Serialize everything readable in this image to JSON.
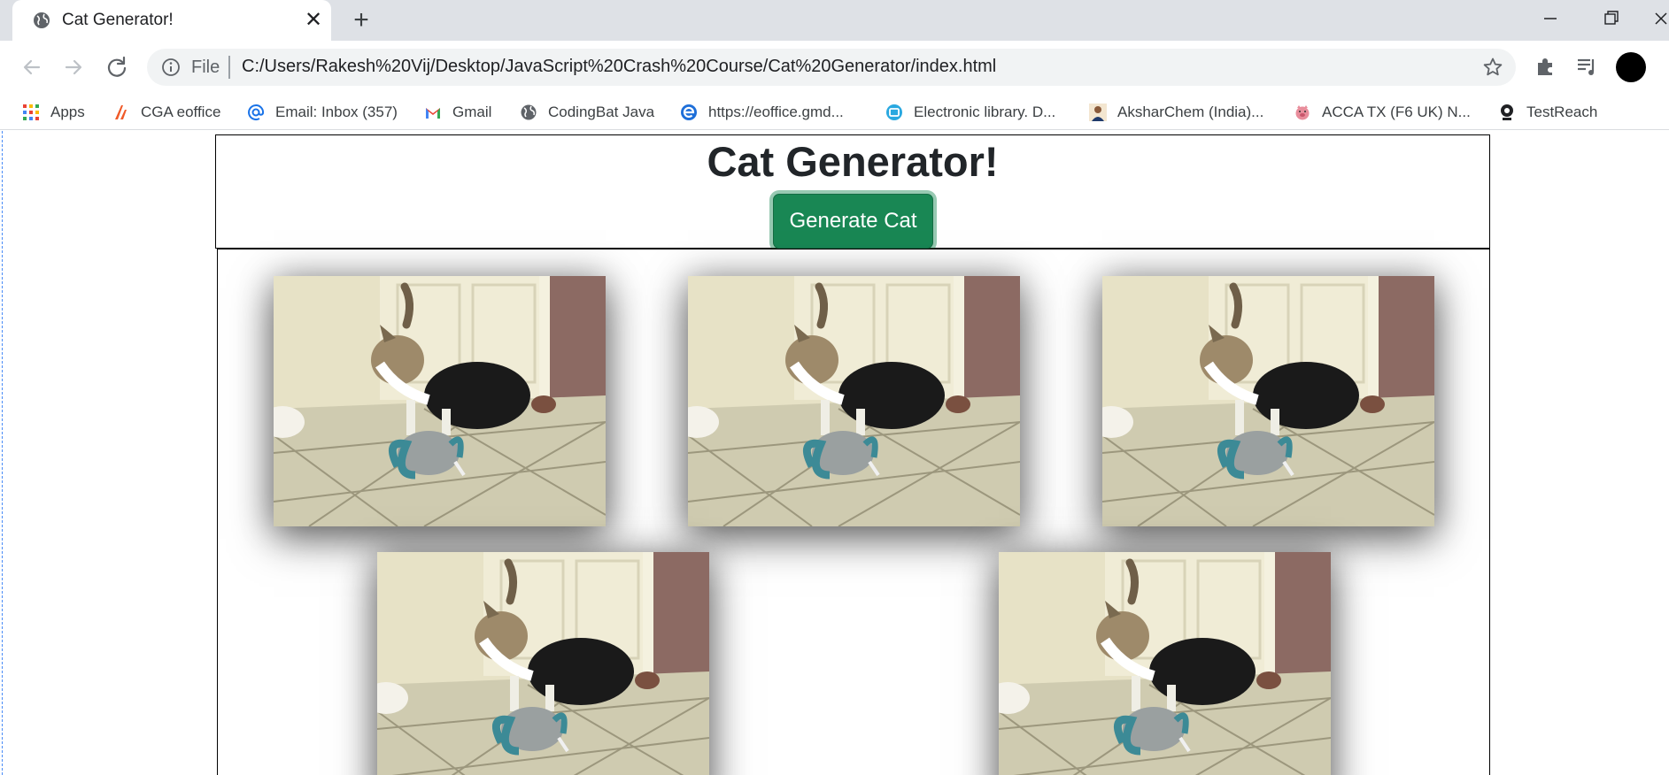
{
  "browser": {
    "tab_title": "Cat Generator!",
    "new_tab_symbol": "+",
    "close_symbol": "✕",
    "scheme": "File",
    "url": "C:/Users/Rakesh%20Vij/Desktop/JavaScript%20Crash%20Course/Cat%20Generator/index.html",
    "bookmarks": [
      {
        "label": "Apps",
        "icon": "apps-grid-icon"
      },
      {
        "label": "CGA eoffice",
        "icon": "cga-logo-icon"
      },
      {
        "label": "Email: Inbox (357)",
        "icon": "email-at-icon"
      },
      {
        "label": "Gmail",
        "icon": "gmail-icon"
      },
      {
        "label": "CodingBat Java",
        "icon": "globe-icon"
      },
      {
        "label": "https://eoffice.gmd...",
        "icon": "ie-icon"
      },
      {
        "label": "Electronic library. D...",
        "icon": "library-icon"
      },
      {
        "label": "AksharChem (India)...",
        "icon": "person-photo-icon"
      },
      {
        "label": "ACCA TX (F6 UK) N...",
        "icon": "pig-icon"
      },
      {
        "label": "TestReach",
        "icon": "webcam-icon"
      }
    ]
  },
  "page": {
    "title": "Cat Generator!",
    "button_label": "Generate Cat",
    "cat_count": 5,
    "colors": {
      "button": "#198754",
      "title": "#212529"
    }
  }
}
